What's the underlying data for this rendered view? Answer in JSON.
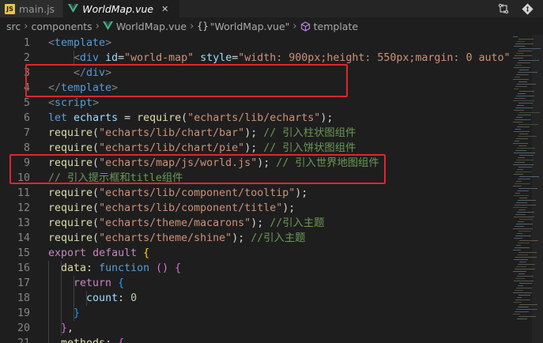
{
  "tabs": [
    {
      "label": "main.js",
      "icon": "js-file-icon",
      "active": false
    },
    {
      "label": "WorldMap.vue",
      "icon": "vue-file-icon",
      "active": true
    }
  ],
  "tab_actions": [
    "compare-icon",
    "git-icon"
  ],
  "breadcrumb": {
    "items": [
      "src",
      "components",
      "WorldMap.vue",
      "\"WorldMap.vue\"",
      "template"
    ],
    "object_symbol": "{}"
  },
  "colors": {
    "highlight_box": "#e0262b",
    "vue": "#42b883"
  },
  "editor": {
    "lines": [
      {
        "n": "1",
        "tokens": [
          [
            "t-punct",
            "<"
          ],
          [
            "t-tag",
            "template"
          ],
          [
            "t-punct",
            ">"
          ]
        ]
      },
      {
        "n": "2",
        "tokens": [
          [
            "t-txt",
            "    "
          ],
          [
            "t-punct",
            "<"
          ],
          [
            "t-tag",
            "div"
          ],
          [
            "t-txt",
            " "
          ],
          [
            "t-attr",
            "id"
          ],
          [
            "t-txt",
            "="
          ],
          [
            "t-str",
            "\"world-map\""
          ],
          [
            "t-txt",
            " "
          ],
          [
            "t-attr",
            "style"
          ],
          [
            "t-txt",
            "="
          ],
          [
            "t-str",
            "\"width: 900px;height: 550px;margin: 0 auto\""
          ],
          [
            "t-punct",
            ">"
          ]
        ]
      },
      {
        "n": "3",
        "tokens": [
          [
            "t-txt",
            "    "
          ],
          [
            "t-punct",
            "</"
          ],
          [
            "t-tag",
            "div"
          ],
          [
            "t-punct",
            ">"
          ]
        ]
      },
      {
        "n": "4",
        "tokens": [
          [
            "t-punct",
            "</"
          ],
          [
            "t-tag",
            "template"
          ],
          [
            "t-punct",
            ">"
          ]
        ]
      },
      {
        "n": "5",
        "tokens": [
          [
            "t-punct",
            "<"
          ],
          [
            "t-tag",
            "script"
          ],
          [
            "t-punct",
            ">"
          ]
        ]
      },
      {
        "n": "6",
        "tokens": [
          [
            "t-kw",
            "let"
          ],
          [
            "t-txt",
            " "
          ],
          [
            "t-var",
            "echarts"
          ],
          [
            "t-txt",
            " = "
          ],
          [
            "t-fn",
            "require"
          ],
          [
            "t-txt",
            "("
          ],
          [
            "t-str",
            "\"echarts/lib/echarts\""
          ],
          [
            "t-txt",
            ");"
          ]
        ]
      },
      {
        "n": "7",
        "tokens": [
          [
            "t-fn",
            "require"
          ],
          [
            "t-txt",
            "("
          ],
          [
            "t-str",
            "\"echarts/lib/chart/bar\""
          ],
          [
            "t-txt",
            "); "
          ],
          [
            "t-cmt",
            "// 引入柱状图组件"
          ]
        ]
      },
      {
        "n": "8",
        "tokens": [
          [
            "t-fn",
            "require"
          ],
          [
            "t-txt",
            "("
          ],
          [
            "t-str",
            "\"echarts/lib/chart/pie\""
          ],
          [
            "t-txt",
            "); "
          ],
          [
            "t-cmt",
            "// 引入饼状图组件"
          ]
        ]
      },
      {
        "n": "9",
        "tokens": [
          [
            "t-fn",
            "require"
          ],
          [
            "t-txt",
            "("
          ],
          [
            "t-str",
            "\"echarts/map/js/world.js\""
          ],
          [
            "t-txt",
            "); "
          ],
          [
            "t-cmt",
            "// 引入世界地图组件"
          ]
        ]
      },
      {
        "n": "10",
        "tokens": [
          [
            "t-cmt",
            "// 引入提示框和title组件"
          ]
        ]
      },
      {
        "n": "11",
        "tokens": [
          [
            "t-fn",
            "require"
          ],
          [
            "t-txt",
            "("
          ],
          [
            "t-str",
            "\"echarts/lib/component/tooltip\""
          ],
          [
            "t-txt",
            ");"
          ]
        ]
      },
      {
        "n": "12",
        "tokens": [
          [
            "t-fn",
            "require"
          ],
          [
            "t-txt",
            "("
          ],
          [
            "t-str",
            "\"echarts/lib/component/title\""
          ],
          [
            "t-txt",
            ");"
          ]
        ]
      },
      {
        "n": "13",
        "tokens": [
          [
            "t-fn",
            "require"
          ],
          [
            "t-txt",
            "("
          ],
          [
            "t-str",
            "\"echarts/theme/macarons\""
          ],
          [
            "t-txt",
            "); "
          ],
          [
            "t-cmt",
            "//引入主题"
          ]
        ]
      },
      {
        "n": "14",
        "tokens": [
          [
            "t-fn",
            "require"
          ],
          [
            "t-txt",
            "("
          ],
          [
            "t-str",
            "\"echarts/theme/shine\""
          ],
          [
            "t-txt",
            "); "
          ],
          [
            "t-cmt",
            "//引入主题"
          ]
        ]
      },
      {
        "n": "15",
        "tokens": [
          [
            "t-ctl",
            "export"
          ],
          [
            "t-txt",
            " "
          ],
          [
            "t-ctl",
            "default"
          ],
          [
            "t-txt",
            " "
          ],
          [
            "t-brace",
            "{"
          ]
        ]
      },
      {
        "n": "16",
        "tokens": [
          [
            "t-txt",
            "  "
          ],
          [
            "t-fn",
            "data"
          ],
          [
            "t-txt",
            ": "
          ],
          [
            "t-kw",
            "function"
          ],
          [
            "t-txt",
            " "
          ],
          [
            "t-brace2",
            "()"
          ],
          [
            "t-txt",
            " "
          ],
          [
            "t-brace2",
            "{"
          ]
        ]
      },
      {
        "n": "17",
        "tokens": [
          [
            "t-txt",
            "    "
          ],
          [
            "t-ctl",
            "return"
          ],
          [
            "t-txt",
            " "
          ],
          [
            "t-brace3",
            "{"
          ]
        ]
      },
      {
        "n": "18",
        "tokens": [
          [
            "t-txt",
            "      "
          ],
          [
            "t-var",
            "count"
          ],
          [
            "t-txt",
            ": "
          ],
          [
            "t-num",
            "0"
          ]
        ]
      },
      {
        "n": "19",
        "tokens": [
          [
            "t-txt",
            "    "
          ],
          [
            "t-brace3",
            "}"
          ]
        ]
      },
      {
        "n": "20",
        "tokens": [
          [
            "t-txt",
            "  "
          ],
          [
            "t-brace2",
            "}"
          ],
          [
            "t-txt",
            ","
          ]
        ]
      },
      {
        "n": "21",
        "tokens": [
          [
            "t-txt",
            "  "
          ],
          [
            "t-fn",
            "methods"
          ],
          [
            "t-txt",
            ": "
          ],
          [
            "t-brace2",
            "{"
          ]
        ]
      }
    ]
  }
}
